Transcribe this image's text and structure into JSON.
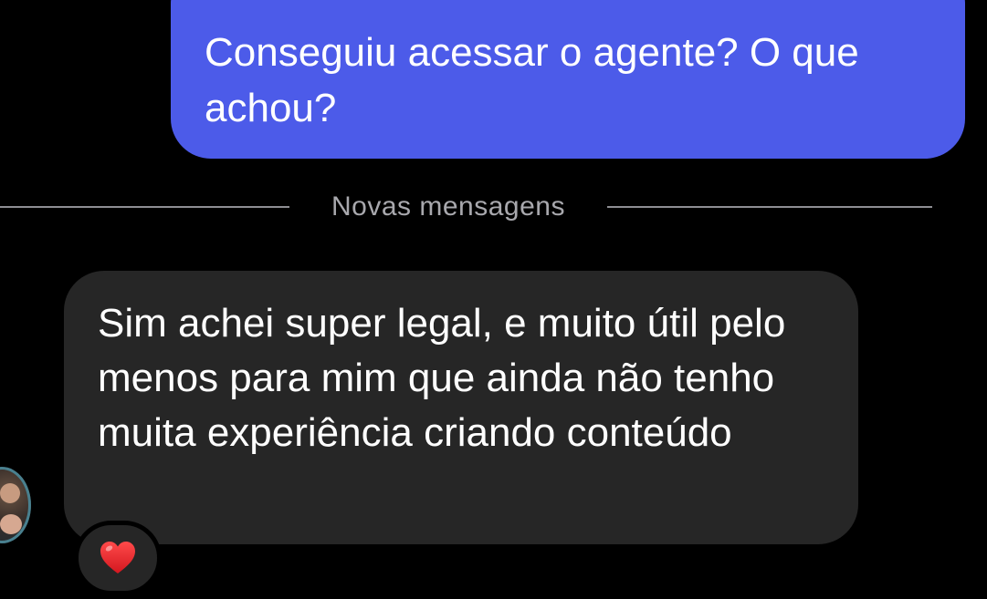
{
  "messages": {
    "outgoing": {
      "text": "Conseguiu acessar o agente? O que achou?"
    },
    "divider": {
      "label": "Novas mensagens"
    },
    "incoming": {
      "text": "Sim achei super legal, e muito útil pelo menos para mim que ainda não tenho muita experiência criando conteúdo",
      "reaction_icon": "red-heart",
      "avatar": "contact-avatar"
    }
  },
  "colors": {
    "outgoing_bubble": "#4c5be9",
    "incoming_bubble": "#262626",
    "background": "#000000",
    "divider": "#8e8e93",
    "heart": "#e0232e"
  }
}
